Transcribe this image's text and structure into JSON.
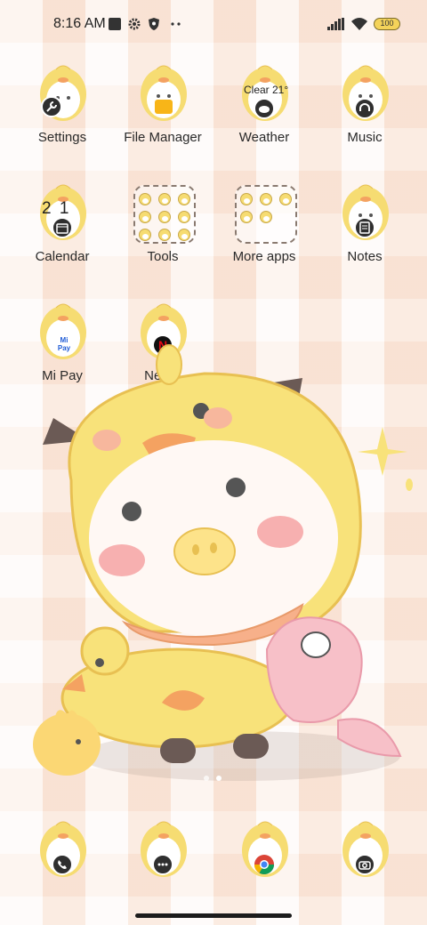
{
  "status_bar": {
    "time": "8:16 AM",
    "battery": "100",
    "icons": [
      "stop-square-icon",
      "gear-icon",
      "shield-icon",
      "more-dots-icon",
      "signal-icon",
      "wifi-icon",
      "battery-icon"
    ]
  },
  "apps": [
    {
      "label": "Settings",
      "badge": "wrench-icon"
    },
    {
      "label": "File Manager",
      "badge": "folder-icon"
    },
    {
      "label": "Weather",
      "badge": "cloud-icon",
      "overlay": "Clear 21°"
    },
    {
      "label": "Music",
      "badge": "headphones-icon"
    },
    {
      "label": "Calendar",
      "badge": "calendar-icon",
      "overlay": "2 1"
    },
    {
      "label": "Tools",
      "badge": "folder-grid"
    },
    {
      "label": "More apps",
      "badge": "folder-grid"
    },
    {
      "label": "Notes",
      "badge": "notes-icon"
    },
    {
      "label": "Mi Pay",
      "badge": "mi-pay-icon",
      "overlay": "Mi Pay"
    },
    {
      "label": "Netflix",
      "badge": "netflix-icon",
      "overlay": "N"
    }
  ],
  "dock": [
    {
      "badge": "phone-icon"
    },
    {
      "badge": "messages-icon"
    },
    {
      "badge": "chrome-icon"
    },
    {
      "badge": "camera-icon"
    }
  ],
  "page_indicator": {
    "pages": 2,
    "active": 2
  },
  "colors": {
    "accent_yellow": "#f6dc72",
    "accent_orange": "#f4a261",
    "badge_dark": "#2f2f2f",
    "background": "#fbefe6"
  }
}
